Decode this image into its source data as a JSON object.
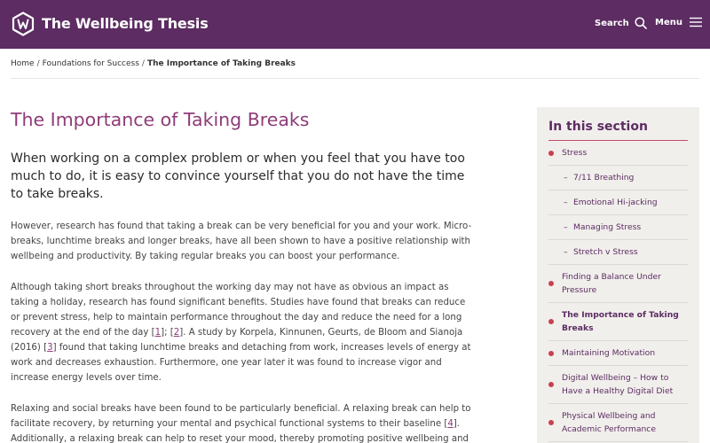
{
  "header": {
    "brand": "The Wellbeing Thesis",
    "search_label": "Search",
    "menu_label": "Menu",
    "icons": [
      "wellbeing-logo-icon",
      "search-icon",
      "hamburger-menu-icon"
    ],
    "colors": {
      "header_bg": "#5c2c62",
      "accent": "#8e3c78",
      "bullet": "#c7404f"
    }
  },
  "breadcrumb": {
    "items": [
      "Home",
      "Foundations for Success"
    ],
    "current": "The Importance of Taking Breaks"
  },
  "main": {
    "title": "The Importance of Taking Breaks",
    "lead": "When working on a complex problem or when you feel that you have too much to do, it is easy to convince yourself that you do not have the time to take breaks.",
    "p1": "However, research has found that taking a break can be very beneficial for you and your work.  Micro-breaks, lunchtime breaks and longer breaks, have all been shown to have a positive relationship with wellbeing and productivity. By taking regular breaks you can boost your performance.",
    "p2_a": "Although taking short breaks throughout the working day may not have as obvious an impact as taking a holiday, research has found significant benefits. Studies have found that breaks can reduce or prevent stress, help to maintain performance throughout the day and reduce the need for a long recovery at the end of the day [",
    "ref1": "1",
    "p2_b": "]; [",
    "ref2": "2",
    "p2_c": "]. A study by Korpela, Kinnunen, Geurts, de Bloom and Sianoja (2016) [",
    "ref3": "3",
    "p2_d": "] found that taking lunchtime breaks and detaching from work, increases levels of energy at work and decreases exhaustion. Furthermore, one year later it was found to increase vigor and increase energy levels over time.",
    "p3_a": "Relaxing and social breaks have been found to be particularly beneficial. A relaxing break can help to facilitate recovery, by returning your mental and psychical functional systems to their baseline [",
    "ref4": "4",
    "p3_b": "]. Additionally, a relaxing break can help to reset your mood, thereby promoting positive wellbeing and"
  },
  "sidebar": {
    "title": "In this section",
    "items": [
      {
        "label": "Stress",
        "level": "top"
      },
      {
        "label": "7/11 Breathing",
        "level": "sub"
      },
      {
        "label": "Emotional Hi-jacking",
        "level": "sub"
      },
      {
        "label": "Managing Stress",
        "level": "sub"
      },
      {
        "label": "Stretch v Stress",
        "level": "sub"
      },
      {
        "label": "Finding a Balance Under Pressure",
        "level": "top"
      },
      {
        "label": "The Importance of Taking Breaks",
        "level": "top",
        "active": true
      },
      {
        "label": "Maintaining Motivation",
        "level": "top"
      },
      {
        "label": "Digital Wellbeing – How to Have a Healthy Digital Diet",
        "level": "top"
      },
      {
        "label": "Physical Wellbeing and Academic Performance",
        "level": "top"
      }
    ]
  }
}
